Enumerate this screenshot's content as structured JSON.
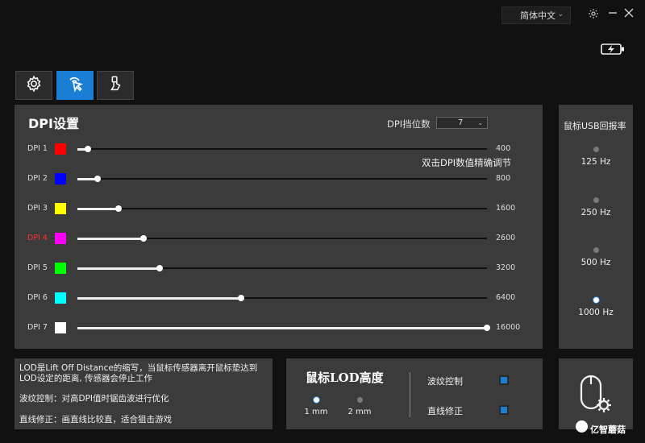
{
  "titlebar": {
    "language": "简体中文",
    "icons": [
      "chevron-down-icon",
      "gear-icon",
      "minimize-icon",
      "close-icon",
      "battery-charging-icon"
    ]
  },
  "tabs": [
    {
      "name": "settings",
      "icon": "gear-icon",
      "active": false
    },
    {
      "name": "dpi",
      "icon": "cursor-click-icon",
      "active": true
    },
    {
      "name": "macro",
      "icon": "hand-touch-icon",
      "active": false
    }
  ],
  "dpi": {
    "title": "DPI设置",
    "count_label": "DPI挡位数",
    "count_value": "7",
    "hint": "双击DPI数值精确调节",
    "levels": [
      {
        "label": "DPI 1",
        "color": "#ff0000",
        "value": "400",
        "fraction": 0.025
      },
      {
        "label": "DPI 2",
        "color": "#0000ff",
        "value": "800",
        "fraction": 0.05
      },
      {
        "label": "DPI 3",
        "color": "#ffff00",
        "value": "1600",
        "fraction": 0.1
      },
      {
        "label": "DPI 4",
        "color": "#ff00ff",
        "value": "2600",
        "fraction": 0.162,
        "label_color": "#ff3030"
      },
      {
        "label": "DPI 5",
        "color": "#00ff00",
        "value": "3200",
        "fraction": 0.2
      },
      {
        "label": "DPI 6",
        "color": "#00ffff",
        "value": "6400",
        "fraction": 0.4
      },
      {
        "label": "DPI 7",
        "color": "#ffffff",
        "value": "16000",
        "fraction": 1.0
      }
    ]
  },
  "usb": {
    "title": "鼠标USB回报率",
    "rates": [
      {
        "label": "125 Hz",
        "selected": false
      },
      {
        "label": "250 Hz",
        "selected": false
      },
      {
        "label": "500 Hz",
        "selected": false
      },
      {
        "label": "1000 Hz",
        "selected": true
      }
    ]
  },
  "info": {
    "line1": "LOD是Lift Off Distance的缩写，当鼠标传感器离开鼠标垫达到",
    "line2": "LOD设定的距离, 传感器会停止工作",
    "line3": "波纹控制：对高DPI值时锯齿波进行优化",
    "line4": "直线修正：画直线比较直，适合狙击游戏"
  },
  "lod": {
    "title": "鼠标LOD高度",
    "options": [
      {
        "label": "1 mm",
        "selected": true
      },
      {
        "label": "2 mm",
        "selected": false
      }
    ],
    "ripple_label": "波纹控制",
    "ripple_on": true,
    "straight_label": "直线修正",
    "straight_on": true
  },
  "mouse_panel": {
    "icon": "mouse-settings-icon"
  },
  "watermark": {
    "text": "亿智蘑菇"
  }
}
